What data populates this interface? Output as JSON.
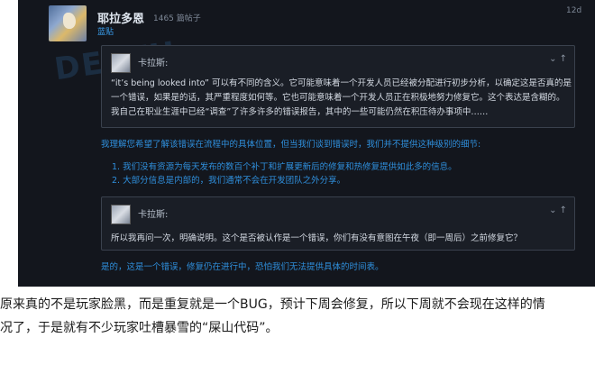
{
  "post": {
    "author": "耶拉多恩",
    "post_count": "1465 篇帖子",
    "role": "蓝贴",
    "time": "12d",
    "watermark": "DEATH",
    "quote1": {
      "author": "卡拉斯:",
      "lines": [
        "“it’s being looked into” 可以有不同的含义。它可能意味着一个开发人员已经被分配进行初步分析，以确定这是否真的是",
        "一个错误，如果是的话，其严重程度如何等。它也可能意味着一个开发人员正在积极地努力修复它。这个表达是含糊的。",
        "我自己在职业生涯中已经“调查”了许多许多的错误报告，其中的一些可能仍然在积压待办事项中……"
      ]
    },
    "reply_intro": "我理解您希望了解该错误在流程中的具体位置，但当我们谈到错误时，我们并不提供这种级别的细节:",
    "reply_items": [
      "1. 我们没有资源为每天发布的数百个补丁和扩展更新后的修复和热修复提供如此多的信息。",
      "2. 大部分信息是内部的，我们通常不会在开发团队之外分享。"
    ],
    "quote2": {
      "author": "卡拉斯:",
      "lines": [
        "所以我再问一次，明确说明。这个是否被认作是一个错误，你们有没有意图在午夜（即一周后）之前修复它？"
      ]
    },
    "reply_final": "是的，这是一个错误，修复仍在进行中，恐怕我们无法提供具体的时间表。",
    "quote_icons": "⌄ ↑"
  },
  "caption": {
    "line1": "原来真的不是玩家脸黑，而是重复就是一个BUG，预计下周会修复，所以下周就不会现在这样的情",
    "line2": "况了，于是就有不少玩家吐槽暴雪的“屎山代码”。"
  },
  "colors": {
    "background": "#13161d",
    "accent_blue": "#2f8fdc",
    "quote_bg": "#1a1e26"
  }
}
